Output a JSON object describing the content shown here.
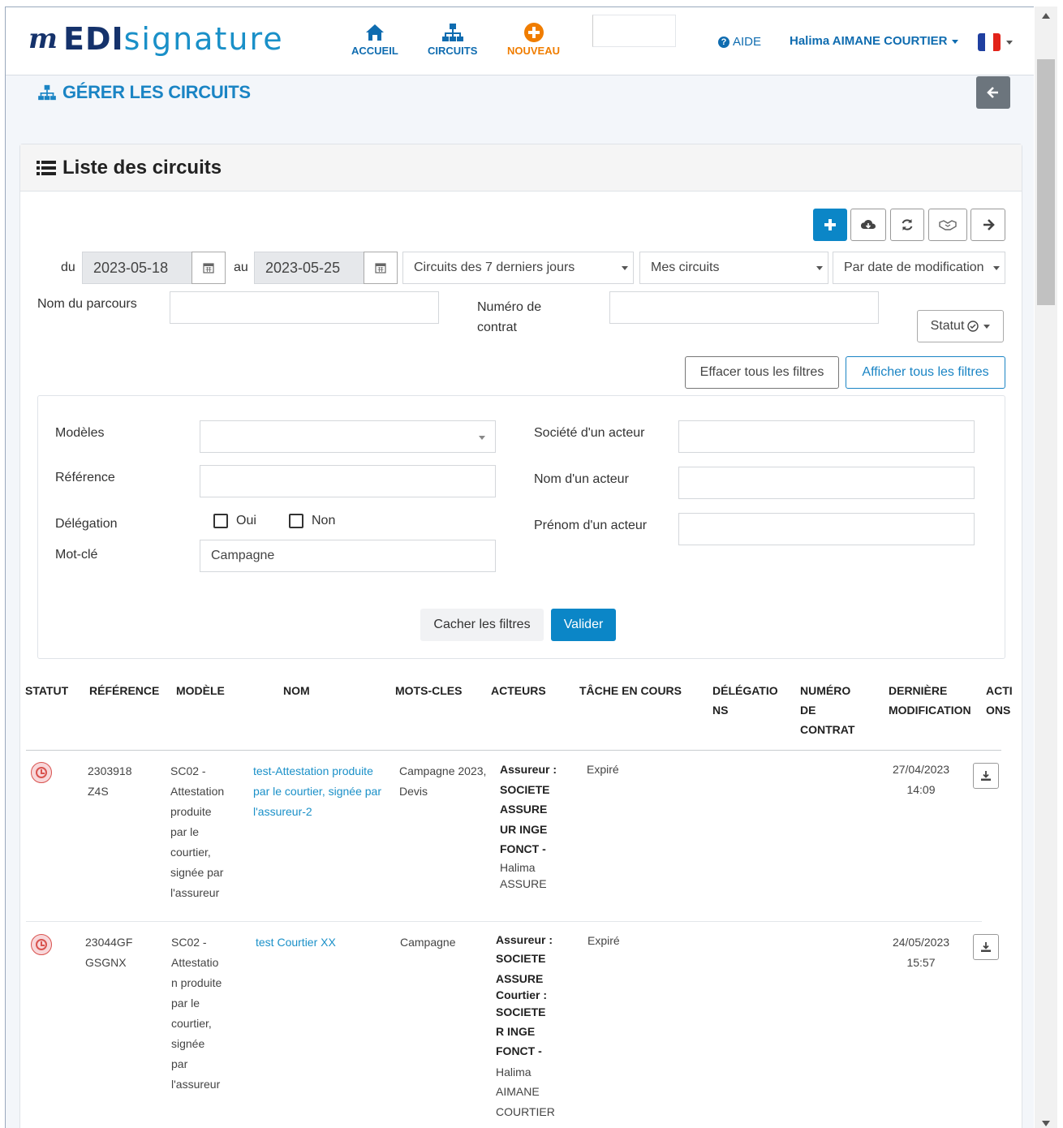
{
  "nav": {
    "logo_prefix": "m",
    "logo_bold": "EDI",
    "logo_light": "signature",
    "accueil": "ACCUEIL",
    "circuits": "CIRCUITS",
    "nouveau": "NOUVEAU",
    "aide": "AIDE",
    "user": "Halima AIMANE COURTIER"
  },
  "page": {
    "title": "GÉRER LES CIRCUITS",
    "panel_title": "Liste des circuits"
  },
  "filters": {
    "du_label": "du",
    "date_from": "2023-05-18",
    "au_label": "au",
    "date_to": "2023-05-25",
    "period_select": "Circuits des 7 derniers jours",
    "scope_select": "Mes circuits",
    "sort_select": "Par date de modification",
    "nom_parcours_label": "Nom du parcours",
    "numero_contrat_label": "Numéro de contrat",
    "statut_button": "Statut",
    "effacer_button": "Effacer tous les filtres",
    "afficher_button": "Afficher tous les filtres",
    "modeles_label": "Modèles",
    "reference_label": "Référence",
    "delegation_label": "Délégation",
    "oui_label": "Oui",
    "non_label": "Non",
    "motcle_label": "Mot-clé",
    "motcle_value": "Campagne",
    "societe_label": "Société d'un acteur",
    "nom_acteur_label": "Nom d'un acteur",
    "prenom_acteur_label": "Prénom d'un acteur",
    "cacher_button": "Cacher les filtres",
    "valider_button": "Valider"
  },
  "table": {
    "headers": {
      "statut": "STATUT",
      "reference": "RÉFÉRENCE",
      "modele": "MODÈLE",
      "nom": "NOM",
      "mots_cles": "MOTS-CLES",
      "acteurs": "ACTEURS",
      "tache": "TÂCHE EN COURS",
      "delegations_1": "DÉLÉGATIO",
      "delegations_2": "NS",
      "numero_1": "NUMÉRO",
      "numero_2": "DE",
      "numero_3": "CONTRAT",
      "derniere_1": "DERNIÈRE",
      "derniere_2": "MODIFICATION",
      "actions_1": "ACTI",
      "actions_2": "ONS"
    },
    "rows": [
      {
        "ref_1": "2303918",
        "ref_2": "Z4S",
        "modele": [
          "SC02 -",
          "Attestation",
          "produite",
          "par le",
          "courtier,",
          "signée par",
          "l'assureur"
        ],
        "nom": [
          "test-Attestation produite",
          "par le courtier, signée par",
          "l'assureur-2"
        ],
        "mots_1": "Campagne 2023,",
        "mots_2": "Devis",
        "acteurs_bold": [
          "Assureur :",
          "SOCIETE",
          "ASSURE",
          "UR INGE",
          "FONCT -"
        ],
        "acteurs_normal": [
          "Halima",
          "ASSURE"
        ],
        "tache": "Expiré",
        "date": "27/04/2023",
        "time": "14:09"
      },
      {
        "ref_1": "23044GF",
        "ref_2": "GSGNX",
        "modele": [
          "SC02 -",
          "Attestatio",
          "n produite",
          "par le",
          "courtier,",
          "signée",
          "par",
          "l'assureur"
        ],
        "nom": [
          "test Courtier XX"
        ],
        "mots_1": "Campagne",
        "acteurs_bold": [
          "Assureur :",
          "SOCIETE",
          "ASSURE",
          "Courtier :",
          "SOCIETE",
          "R INGE",
          "FONCT -"
        ],
        "acteurs_normal": [
          "Halima",
          "AIMANE",
          "COURTIER"
        ],
        "tache": "Expiré",
        "date": "24/05/2023",
        "time": "15:57"
      }
    ]
  },
  "colors": {
    "primary": "#0b86c7",
    "link": "#1a90c8",
    "navy": "#15326b",
    "orange": "#f07d00",
    "danger": "#d9534f"
  },
  "icons": [
    "home-icon",
    "sitemap-icon",
    "plus-circle-icon",
    "question-circle-icon",
    "arrow-left-icon",
    "list-icon",
    "plus-icon",
    "cloud-download-icon",
    "refresh-icon",
    "handshake-icon",
    "arrow-right-icon",
    "calendar-icon",
    "check-circle-icon",
    "clock-status-icon",
    "download-icon"
  ]
}
